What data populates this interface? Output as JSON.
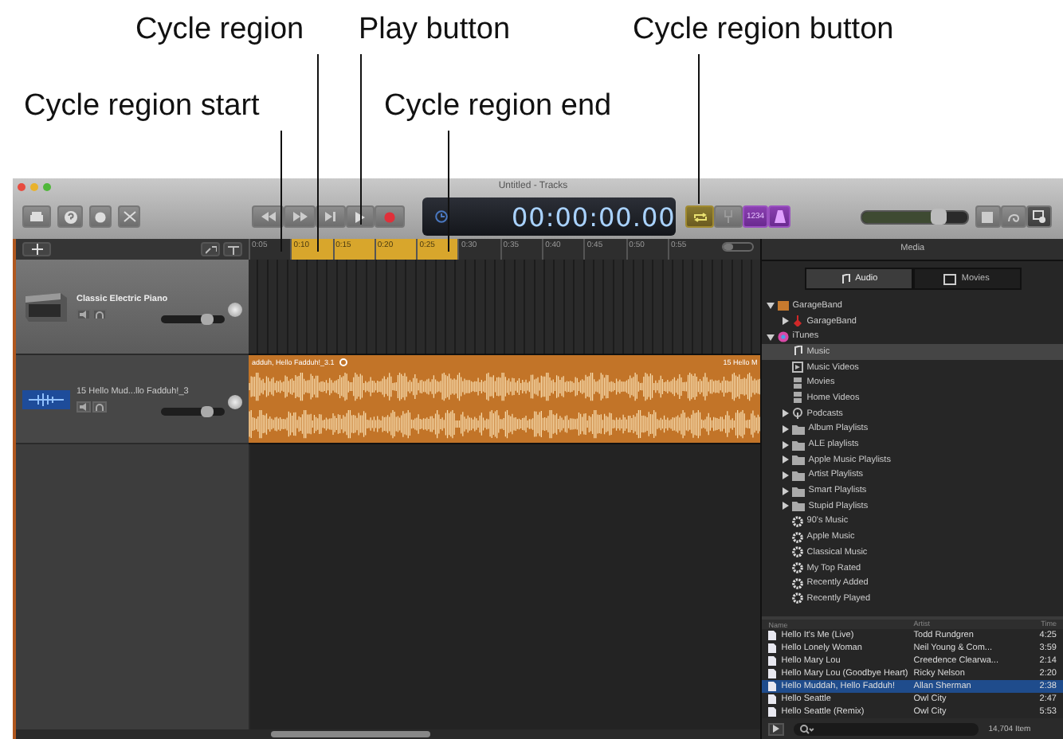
{
  "callouts": [
    {
      "text": "Cycle region"
    },
    {
      "text": "Play button"
    },
    {
      "text": "Cycle region button"
    },
    {
      "text": "Cycle region start"
    },
    {
      "text": "Cycle region end"
    }
  ],
  "window": {
    "title": "Untitled - Tracks"
  },
  "toolbar": {
    "display": {
      "time": "00:00:00.00"
    },
    "cycle_button": {
      "on": true
    },
    "count_in": {
      "text": "1234"
    },
    "master_volume": {
      "level": 0.72
    },
    "media_button": {
      "selected": true
    }
  },
  "ruler": {
    "ticks": [
      {
        "label": "0:05",
        "in_cycle": false
      },
      {
        "label": "0:10",
        "in_cycle": true
      },
      {
        "label": "0:15",
        "in_cycle": true
      },
      {
        "label": "0:20",
        "in_cycle": true
      },
      {
        "label": "0:25",
        "in_cycle": true
      },
      {
        "label": "0:30",
        "in_cycle": false
      },
      {
        "label": "0:35",
        "in_cycle": false
      },
      {
        "label": "0:40",
        "in_cycle": false
      },
      {
        "label": "0:45",
        "in_cycle": false
      },
      {
        "label": "0:50",
        "in_cycle": false
      },
      {
        "label": "0:55",
        "in_cycle": false
      }
    ],
    "zoom_slider": {
      "level": 0.3
    }
  },
  "tracks": [
    {
      "name": "Classic Electric Piano",
      "kind": "piano",
      "selected": true,
      "volume": {
        "level": 0.72
      }
    },
    {
      "name": "15 Hello Mud...llo Fadduh!_3",
      "kind": "audio",
      "selected": false,
      "volume": {
        "level": 0.72
      },
      "regions": [
        "adduh, Hello Fadduh!_3.1",
        "15 Hello M"
      ]
    }
  ],
  "media": {
    "title": "Media",
    "tabs": [
      {
        "label": "Audio",
        "selected": true
      },
      {
        "label": "Movies",
        "selected": false
      }
    ],
    "tree": [
      {
        "label": "GarageBand",
        "kind": "app",
        "selected": false,
        "expanded": true,
        "children": [
          {
            "label": "GarageBand",
            "kind": "guitar",
            "selected": false,
            "expanded": false
          }
        ]
      },
      {
        "label": "iTunes",
        "kind": "itunes",
        "selected": false,
        "expanded": true,
        "children": [
          {
            "label": "Music",
            "kind": "music",
            "selected": true
          },
          {
            "label": "Music Videos",
            "kind": "video",
            "selected": false
          },
          {
            "label": "Movies",
            "kind": "film",
            "selected": false
          },
          {
            "label": "Home Videos",
            "kind": "film",
            "selected": false
          },
          {
            "label": "Podcasts",
            "kind": "podcast",
            "selected": false,
            "expanded": false
          },
          {
            "label": "Album Playlists",
            "kind": "folder",
            "selected": false,
            "expanded": false
          },
          {
            "label": "ALE playlists",
            "kind": "folder",
            "selected": false,
            "expanded": false
          },
          {
            "label": "Apple Music Playlists",
            "kind": "folder",
            "selected": false,
            "expanded": false
          },
          {
            "label": "Artist Playlists",
            "kind": "folder",
            "selected": false,
            "expanded": false
          },
          {
            "label": "Smart Playlists",
            "kind": "folder",
            "selected": false,
            "expanded": false
          },
          {
            "label": "Stupid Playlists",
            "kind": "folder",
            "selected": false,
            "expanded": false
          },
          {
            "label": "90's Music",
            "kind": "smart",
            "selected": false
          },
          {
            "label": "Apple Music",
            "kind": "smart",
            "selected": false
          },
          {
            "label": "Classical Music",
            "kind": "smart",
            "selected": false
          },
          {
            "label": "My Top Rated",
            "kind": "smart",
            "selected": false
          },
          {
            "label": "Recently Added",
            "kind": "smart",
            "selected": false
          },
          {
            "label": "Recently Played",
            "kind": "smart",
            "selected": false
          }
        ]
      }
    ],
    "songs": {
      "columns": [
        "Name",
        "Artist",
        "Time"
      ],
      "rows": [
        {
          "name": "Hello It's Me (Live)",
          "artist": "Todd Rundgren",
          "time": "4:25",
          "selected": false
        },
        {
          "name": "Hello Lonely Woman",
          "artist": "Neil Young & Com...",
          "time": "3:59",
          "selected": false
        },
        {
          "name": "Hello Mary Lou",
          "artist": "Creedence Clearwa...",
          "time": "2:14",
          "selected": false
        },
        {
          "name": "Hello Mary Lou (Goodbye Heart)",
          "artist": "Ricky Nelson",
          "time": "2:20",
          "selected": false
        },
        {
          "name": "Hello Muddah, Hello Fadduh!",
          "artist": "Allan Sherman",
          "time": "2:38",
          "selected": true
        },
        {
          "name": "Hello Seattle",
          "artist": "Owl City",
          "time": "2:47",
          "selected": false
        },
        {
          "name": "Hello Seattle (Remix)",
          "artist": "Owl City",
          "time": "5:53",
          "selected": false
        }
      ]
    },
    "item_count": "14,704 Item"
  }
}
